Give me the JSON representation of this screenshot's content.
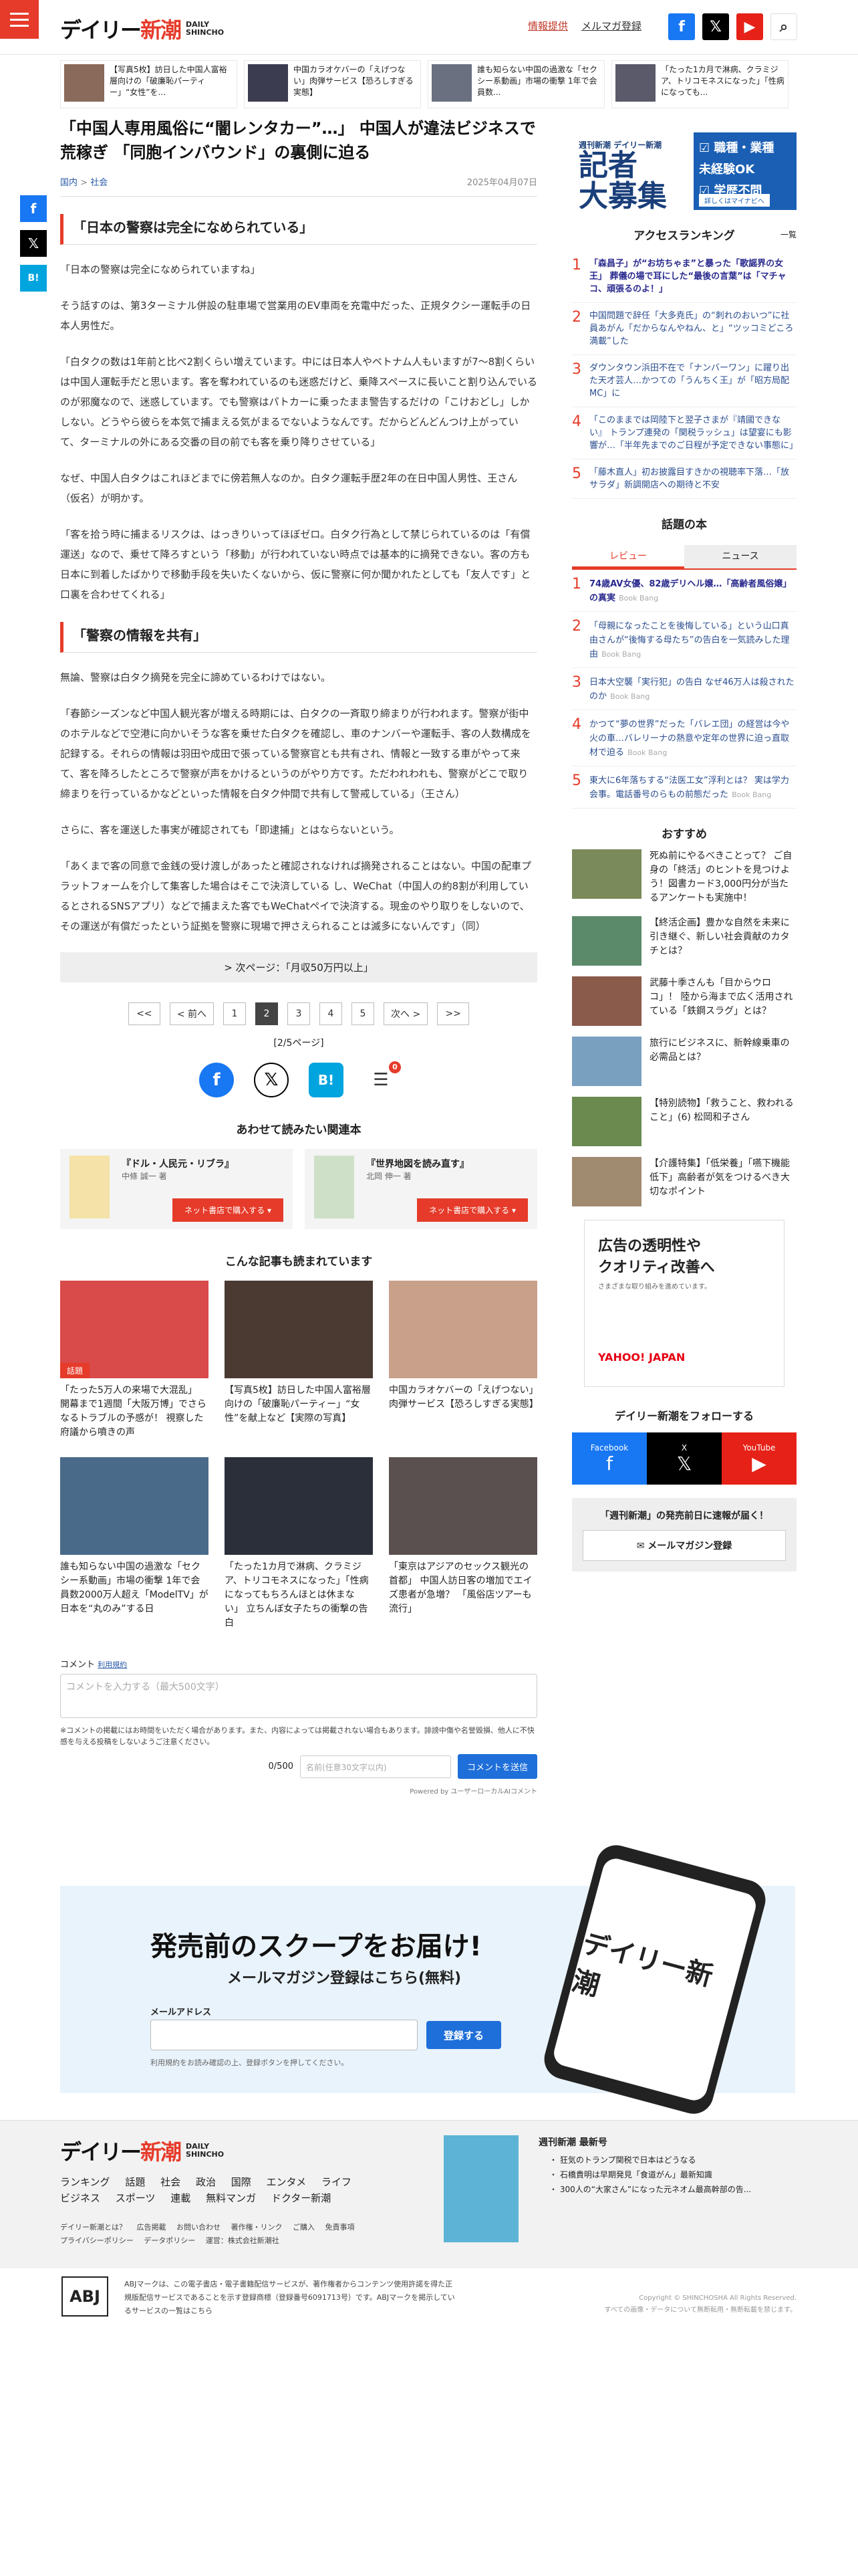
{
  "header": {
    "logo_jp": "デイリー",
    "logo_jp2": "新潮",
    "logo_en1": "DAILY",
    "logo_en2": "SHINCHO",
    "ad_link": "情報提供",
    "mail_link": "メルマガ登録"
  },
  "strip": [
    {
      "text": "【写真5枚】訪日した中国人富裕層向けの「破廉恥パーティー」“女性”を..."
    },
    {
      "text": "中国カラオケバーの「えげつない」肉弾サービス【恐ろしすぎる実態】"
    },
    {
      "text": "誰も知らない中国の過激な「セクシー系動画」市場の衝撃 1年で会員数..."
    },
    {
      "text": "「たった1カ月で淋病、クラミジア、トリコモネスになった」「性病になっても..."
    }
  ],
  "article": {
    "title": "「中国人専用風俗に“闇レンタカー”…」 中国人が違法ビジネスで荒稼ぎ 「同胞インバウンド」の裏側に迫る",
    "crumb_home": "国内",
    "crumb_sep": ">",
    "crumb_cat": "社会",
    "date": "2025年04月07日",
    "h2a": "「日本の警察は完全になめられている」",
    "p1": "「日本の警察は完全になめられていますね」",
    "p2": "そう話すのは、第3ターミナル併設の駐車場で営業用のEV車両を充電中だった、正規タクシー運転手の日本人男性だ。",
    "p3": "「白タクの数は1年前と比べ2割くらい増えています。中には日本人やベトナム人もいますが7〜8割くらいは中国人運転手だと思います。客を奪われているのも迷惑だけど、乗降スペースに長いこと割り込んでいるのが邪魔なので、迷惑しています。でも警察はパトカーに乗ったまま警告するだけの「こけおどし」しかしない。どうやら彼らを本気で捕まえる気がまるでないようなんです。だからどんどんつけ上がっていて、ターミナルの外にある交番の目の前でも客を乗り降りさせている」",
    "p4": "なぜ、中国人白タクはこれほどまでに傍若無人なのか。白タク運転手歴2年の在日中国人男性、王さん（仮名）が明かす。",
    "p5": "「客を拾う時に捕まるリスクは、はっきりいってほぼゼロ。白タク行為として禁じられているのは「有償運送」なので、乗せて降ろすという「移動」が行われていない時点では基本的に摘発できない。客の方も日本に到着したばかりで移動手段を失いたくないから、仮に警察に何か聞かれたとしても「友人です」と口裏を合わせてくれる」",
    "h2b": "「警察の情報を共有」",
    "p6": "無論、警察は白タク摘発を完全に諦めているわけではない。",
    "p7": "「春節シーズンなど中国人観光客が増える時期には、白タクの一斉取り締まりが行われます。警察が街中のホテルなどで空港に向かいそうな客を乗せた白タクを確認し、車のナンバーや運転手、客の人数構成を記録する。それらの情報は羽田や成田で張っている警察官とも共有され、情報と一致する車がやって来て、客を降ろしたところで警察が声をかけるというのがやり方です。ただわれわれも、警察がどこで取り締まりを行っているかなどといった情報を白タク仲間で共有して警戒している」（王さん）",
    "p8": "さらに、客を運送した事実が確認されても「即逮捕」とはならないという。",
    "p9": "「あくまで客の同意で金銭の受け渡しがあったと確認されなければ摘発されることはない。中国の配車プラットフォームを介して集客した場合はそこで決済している し、WeChat（中国人の約8割が利用しているとされるSNSアプリ）などで捕まえた客でもWeChatペイで決済する。現金のやり取りをしないので、その運送が有償だったという証拠を警察に現場で押さえられることは滅多にないんです」（同）",
    "next": "> 次ページ：「月収50万円以上」"
  },
  "pager": {
    "first": "<<",
    "prev": "< 前へ",
    "pages": [
      "1",
      "2",
      "3",
      "4",
      "5"
    ],
    "next": "次へ >",
    "last": ">>",
    "info": "[2/5ページ]",
    "badge": "0"
  },
  "related": {
    "heading": "あわせて読みたい関連本",
    "books": [
      {
        "title": "『ドル・人民元・リブラ』",
        "author": "中條 誠一 著",
        "btn": "ネット書店で購入する ▾"
      },
      {
        "title": "『世界地図を読み直す』",
        "author": "北岡 伸一 著",
        "btn": "ネット書店で購入する ▾"
      }
    ]
  },
  "others": {
    "heading": "こんな記事も読まれています",
    "items": [
      {
        "text": "「たった5万人の来場で大混乱」 開幕まで1週間「大阪万博」でさらなるトラブルの予感が！ 視察した府議から噴きの声",
        "tag": "話題"
      },
      {
        "text": "【写真5枚】訪日した中国人富裕層向けの「破廉恥パーティー」“女性”を献上など【実際の写真】"
      },
      {
        "text": "中国カラオケバーの「えげつない」肉弾サービス【恐ろしすぎる実態】"
      },
      {
        "text": "誰も知らない中国の過激な「セクシー系動画」市場の衝撃 1年で会員数2000万人超え「ModelTV」が日本を“丸のみ”する日"
      },
      {
        "text": "「たった1カ月で淋病、クラミジア、トリコモネスになった」「性病になってもちろんほとは休まない」 立ちんぼ女子たちの衝撃の告白"
      },
      {
        "text": "「東京はアジアのセックス観光の首都」 中国人訪日客の増加でエイズ患者が急増？ 「風俗店ツアーも流行」"
      }
    ]
  },
  "comment": {
    "label": "コメント",
    "rule": "利用規約",
    "placeholder": "コメントを入力する（最大500文字）",
    "note": "※コメントの掲載にはお時間をいただく場合があります。また、内容によっては掲載されない場合もあります。誹謗中傷や名誉毀損、他人に不快感を与える投稿をしないようご注意ください。",
    "count": "0/500",
    "name_ph": "名前(任意30文字以内)",
    "submit": "コメントを送信",
    "powered": "Powered by ユーザーローカルAIコメント"
  },
  "sidebar": {
    "banner": {
      "s": "週刊新潮 デイリー新潮",
      "b1": "記者",
      "b2": "大募集",
      "r1": "☑ 職種・業種",
      "r2": "未経験OK",
      "r3": "☑ 学歴不問",
      "cta": "詳しくはマイナビへ"
    },
    "ranking_title": "アクセスランキング",
    "ranking_all": "一覧",
    "ranking": [
      {
        "n": "1",
        "t": "「森昌子」が“お坊ちゃま”と暴った「歌謡界の女王」 葬儀の場で耳にした“最後の言葉”は「マチャコ、頑張るのよ！」"
      },
      {
        "n": "2",
        "t": "中国問題で辞任「大多尭氏」の“刺れのおいつ”に社員あがん「だからなんやねん、と」“ツッコミどころ満載”した"
      },
      {
        "n": "3",
        "t": "ダウンタウン浜田不在で「ナンバーワン」に躍り出た天才芸人…かつての「うんちく王」が「昭方局配MC」に"
      },
      {
        "n": "4",
        "t": "「このままでは岡陸下と翌子さまが『靖國できない』 トランプ連発の「関税ラッシュ」は望宴にも影響が…「半年先までのご日程が予定できない事態に」"
      },
      {
        "n": "5",
        "t": "「藤木直人」初お披露目すきかの視聴率下落…「放サラダ」新調開店への期待と不安"
      }
    ],
    "books_title": "話題の本",
    "tab_on": "レビュー",
    "tab_off": "ニュース",
    "books": [
      {
        "n": "1",
        "t": "74歳AV女優、82歳デリヘル嬢…「高齢者風俗嬢」の真実",
        "a": "Book Bang"
      },
      {
        "n": "2",
        "t": "「母親になったことを後悔している」という山口真由さんが“後悔する母たち”の告白を一気読みした理由",
        "a": "Book Bang"
      },
      {
        "n": "3",
        "t": "日本大空襲「実行犯」の告白 なぜ46万人は殺されたのか",
        "a": "Book Bang"
      },
      {
        "n": "4",
        "t": "かつて“夢の世界”だった「バレエ団」の経営は今や火の車…バレリーナの熱意や定年の世界に迫っ直取材で迫る",
        "a": "Book Bang"
      },
      {
        "n": "5",
        "t": "東大に6年落ちする“法医工女”浮利とは？ 実は学力会事。電話番号のらもの前態だった",
        "a": "Book Bang"
      }
    ],
    "rec_title": "おすすめ",
    "rec": [
      {
        "t": "死ぬ前にやるべきことって？ ご自身の「終活」のヒントを見つけよう！図書カード3,000円分が当たるアンケートも実施中！"
      },
      {
        "t": "【終活企画】豊かな自然を未来に引き継ぐ、新しい社会貢献のカタチとは？"
      },
      {
        "t": "武藤十季さんも「目からウロコ」！ 陸から海まで広く活用されている「鉄鋼スラグ」とは？"
      },
      {
        "t": "旅行にビジネスに、新幹線乗車の必需品とは？"
      },
      {
        "t": "【特別読物】「救うこと、救われること」(6) 松岡和子さん"
      },
      {
        "t": "【介護特集】「低栄養」「嚥下機能低下」高齢者が気をつけるべき大切なポイント"
      }
    ],
    "ad": {
      "l1": "広告の透明性や",
      "l2": "クオリティ改善へ",
      "l3": "さまざまな取り組みを進めています。",
      "brand": "YAHOO! JAPAN"
    },
    "follow": "デイリー新潮をフォローする",
    "fb": "Facebook",
    "x": "X",
    "yt": "YouTube",
    "mm_title": "「週刊新潮」の発売前日に速報が届く！",
    "mm_btn": "✉ メールマガジン登録"
  },
  "newsletter": {
    "big": "発売前のスクープをお届け!",
    "sm": "メールマガジン登録はこちら(無料)",
    "label": "メールアドレス",
    "btn": "登録する",
    "note": "利用規約をお読み確認の上、登録ボタンを押してください。",
    "phone": "デイリー新潮"
  },
  "footer": {
    "nav": [
      "ランキング",
      "話題",
      "社会",
      "政治",
      "国際",
      "エンタメ",
      "ライフ",
      "ビジネス",
      "スポーツ",
      "連載",
      "無料マンガ",
      "ドクター新潮"
    ],
    "small": [
      "デイリー新潮とは？",
      "広告掲載",
      "お問い合わせ",
      "著作権・リンク",
      "ご購入",
      "免責事項",
      "プライバシーポリシー",
      "データポリシー",
      "運営：株式会社新潮社"
    ],
    "mag_title": "週刊新潮 最新号",
    "mag_lines": [
      "・ 狂気のトランプ関税で日本はどうなる",
      "・ 石橋貴明は早期発見「食道がん」最新知識",
      "・ 300人の“大家さん”になった元ネオム最高幹部の告..."
    ],
    "abj": "ABJ",
    "abj_text": "ABJマークは、この電子書店・電子書籍配信サービスが、著作権者からコンテンツ使用許諾を得た正規版配信サービスであることを示す登録商標（登録番号6091713号）です。ABJマークを掲示しているサービスの一覧はこちら",
    "copy1": "Copyright © SHINCHOSHA All Rights Reserved.",
    "copy2": "すべての画像・データについて無断転用・無断転載を禁じます。"
  }
}
